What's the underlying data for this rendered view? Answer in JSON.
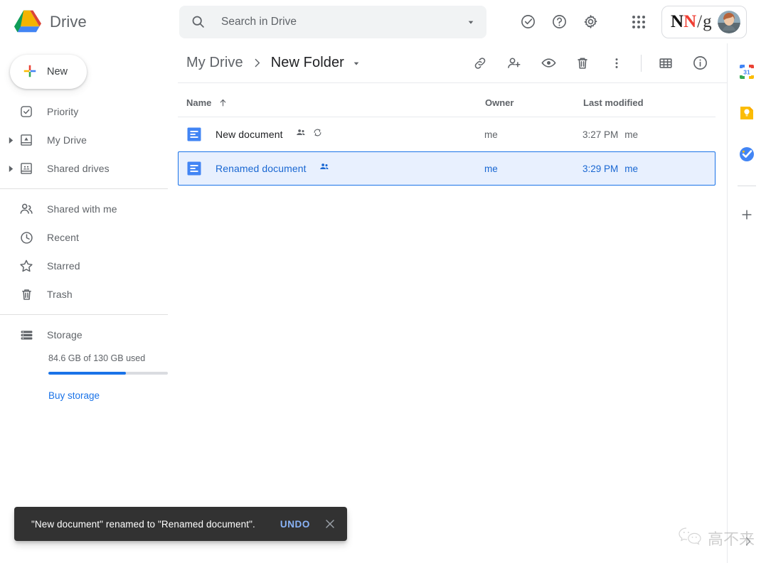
{
  "app": {
    "name": "Drive",
    "logo_icon": "google-drive-logo"
  },
  "search": {
    "placeholder": "Search in Drive",
    "value": "",
    "icon": "search-icon",
    "caret_icon": "chevron-down-icon"
  },
  "top_actions": [
    {
      "name": "support-check-icon",
      "label": "Support"
    },
    {
      "name": "help-icon",
      "label": "Help"
    },
    {
      "name": "settings-gear-icon",
      "label": "Settings"
    },
    {
      "name": "apps-grid-icon",
      "label": "Google apps"
    }
  ],
  "account": {
    "logo_n1": "N",
    "logo_n2": "N",
    "logo_slash": "/",
    "logo_g": "g",
    "avatar_icon": "user-avatar"
  },
  "sidebar": {
    "new_button": {
      "label": "New",
      "icon": "plus-icon"
    },
    "items": [
      {
        "label": "Priority",
        "icon": "priority-check-icon",
        "expandable": false
      },
      {
        "label": "My Drive",
        "icon": "my-drive-icon",
        "expandable": true
      },
      {
        "label": "Shared drives",
        "icon": "shared-drives-icon",
        "expandable": true
      },
      {
        "label": "Shared with me",
        "icon": "people-icon",
        "expandable": false
      },
      {
        "label": "Recent",
        "icon": "clock-icon",
        "expandable": false
      },
      {
        "label": "Starred",
        "icon": "star-icon",
        "expandable": false
      },
      {
        "label": "Trash",
        "icon": "trash-icon",
        "expandable": false
      },
      {
        "label": "Storage",
        "icon": "storage-icon",
        "expandable": false
      }
    ],
    "storage": {
      "used_text": "84.6 GB of 130 GB used",
      "percent_used": 65,
      "buy_label": "Buy storage",
      "bar_color": "#1a73e8"
    }
  },
  "breadcrumb": {
    "root": "My Drive",
    "separator_icon": "chevron-right-icon",
    "current": "New Folder",
    "caret_icon": "chevron-down-icon"
  },
  "toolbar": [
    {
      "name": "get-link-icon",
      "label": "Get link"
    },
    {
      "name": "add-person-icon",
      "label": "Share"
    },
    {
      "name": "preview-eye-icon",
      "label": "Preview"
    },
    {
      "name": "trash-icon",
      "label": "Remove"
    },
    {
      "name": "more-vert-icon",
      "label": "More actions"
    },
    {
      "name": "grid-view-icon",
      "label": "Grid view"
    },
    {
      "name": "details-info-icon",
      "label": "View details"
    }
  ],
  "file_list": {
    "columns": {
      "name": "Name",
      "owner": "Owner",
      "modified": "Last modified"
    },
    "sort_icon": "arrow-up-icon",
    "rows": [
      {
        "name": "New document",
        "icon": "google-docs-icon",
        "badges": [
          "shared-people-icon",
          "sync-icon"
        ],
        "owner": "me",
        "modified_time": "3:27 PM",
        "modified_by": "me",
        "selected": false
      },
      {
        "name": "Renamed document",
        "icon": "google-docs-icon",
        "badges": [
          "shared-people-icon"
        ],
        "owner": "me",
        "modified_time": "3:29 PM",
        "modified_by": "me",
        "selected": true
      }
    ]
  },
  "right_panel": {
    "apps": [
      {
        "name": "google-calendar-icon",
        "label": "Calendar",
        "day": "31"
      },
      {
        "name": "google-keep-icon",
        "label": "Keep"
      },
      {
        "name": "google-tasks-icon",
        "label": "Tasks"
      }
    ],
    "add_label": "Get add-ons",
    "add_icon": "plus-icon"
  },
  "snackbar": {
    "message": "\"New document\" renamed to \"Renamed document\".",
    "undo_label": "UNDO",
    "close_icon": "close-icon"
  },
  "watermark": {
    "text": "高不来",
    "icon": "wechat-icon",
    "chevron": "chevron-right-icon"
  },
  "colors": {
    "accent_blue": "#1a73e8",
    "selected_bg": "#e8f0fe",
    "selected_text": "#1967d2",
    "snackbar_bg": "#323232",
    "undo_blue": "#8ab4f8"
  }
}
